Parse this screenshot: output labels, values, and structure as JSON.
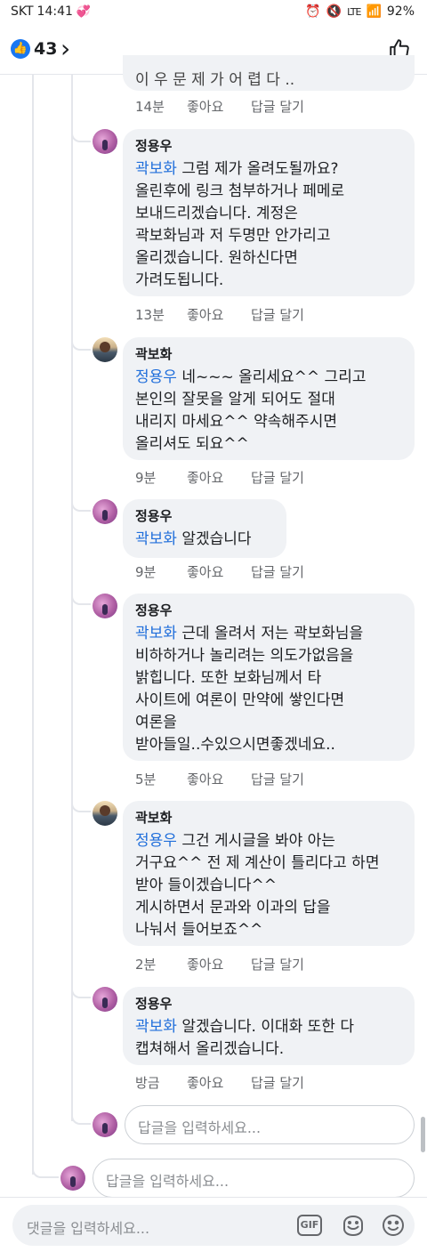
{
  "status": {
    "carrier": "SKT",
    "time": "14:41",
    "battery": "92%",
    "network": "LTE"
  },
  "header": {
    "like_count": "43"
  },
  "top_partial_text": "이 우 문 제 가 어 렵 다 ..",
  "comments": [
    {
      "time": "14분",
      "like": "좋아요",
      "reply": "답글 달기"
    },
    {
      "author": "정용우",
      "mention": "곽보화",
      "text": " 그럼 제가 올려도될까요?\n올린후에 링크 첨부하거나 페메로\n보내드리겠습니다. 계정은\n곽보화님과 저 두명만 안가리고\n올리겠습니다. 원하신다면\n가려도됩니다.",
      "time": "13분",
      "like": "좋아요",
      "reply": "답글 달기"
    },
    {
      "author": "곽보화",
      "mention": "정용우",
      "text": " 네~~~ 올리세요^^ 그리고\n본인의 잘못을 알게 되어도 절대\n내리지 마세요^^ 약속해주시면\n올리셔도 되요^^",
      "time": "9분",
      "like": "좋아요",
      "reply": "답글 달기"
    },
    {
      "author": "정용우",
      "mention": "곽보화",
      "text": " 알겠습니다",
      "time": "9분",
      "like": "좋아요",
      "reply": "답글 달기"
    },
    {
      "author": "정용우",
      "mention": "곽보화",
      "text": " 근데 올려서 저는 곽보화님을\n비하하거나 놀리려는 의도가없음을\n밝힙니다. 또한 보화님께서 타\n사이트에 여론이 만약에 쌓인다면\n여론을\n받아들일..수있으시면좋겠네요..",
      "time": "5분",
      "like": "좋아요",
      "reply": "답글 달기"
    },
    {
      "author": "곽보화",
      "mention": "정용우",
      "text": " 그건 게시글을 봐야 아는\n거구요^^ 전 제 계산이 틀리다고 하면\n받아 들이겠습니다^^\n게시하면서 문과와 이과의 답을\n나눠서 들어보죠^^",
      "time": "2분",
      "like": "좋아요",
      "reply": "답글 달기"
    },
    {
      "author": "정용우",
      "mention": "곽보화",
      "text": " 알겠습니다. 이대화 또한 다\n캡쳐해서 올리겠습니다.",
      "time": "방금",
      "like": "좋아요",
      "reply": "답글 달기"
    }
  ],
  "reply_placeholder": "답글을 입력하세요...",
  "composer": {
    "placeholder": "댓글을 입력하세요...",
    "gif_label": "GIF"
  }
}
